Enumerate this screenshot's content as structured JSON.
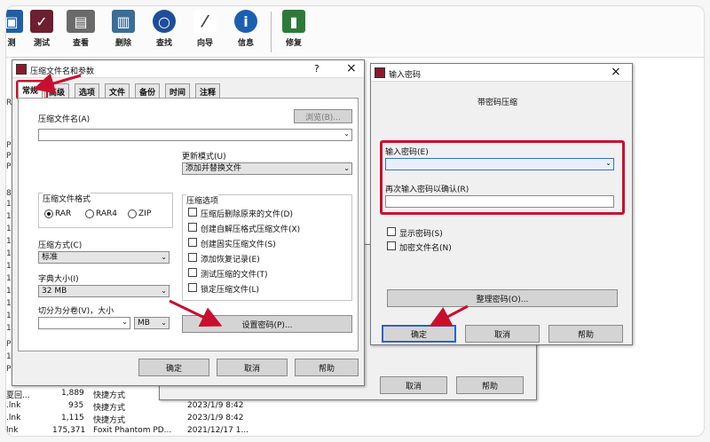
{
  "toolbar": {
    "items": [
      {
        "label": "测",
        "icon": "test-icon",
        "color": "#1f5fa8"
      },
      {
        "label": "测试",
        "icon": "test-clipboard-icon",
        "color": "#6b1f2f"
      },
      {
        "label": "查看",
        "icon": "book-icon",
        "color": "#6a6a6a"
      },
      {
        "label": "删除",
        "icon": "trash-icon",
        "color": "#3a6e98"
      },
      {
        "label": "查找",
        "icon": "magnifier-icon",
        "color": "#1d4e9a"
      },
      {
        "label": "向导",
        "icon": "wand-icon",
        "color": "#444444"
      },
      {
        "label": "信息",
        "icon": "info-icon",
        "color": "#1b5fb0"
      },
      {
        "label": "修复",
        "icon": "repair-book-icon",
        "color": "#2c7a3a"
      }
    ]
  },
  "leftcol": [
    "R",
    "P",
    "P",
    "P",
    "8",
    "1",
    "1",
    "1",
    "1",
    "1",
    "1",
    "1",
    "1",
    "1",
    "1",
    "1",
    "P",
    "1",
    "P"
  ],
  "files": [
    {
      "name": "夏回...",
      "size": "1,889",
      "type": "快捷方式",
      "date": ""
    },
    {
      "name": ".lnk",
      "size": "935",
      "type": "快捷方式",
      "date": "2023/1/9 8:42"
    },
    {
      "name": ".lnk",
      "size": "1,115",
      "type": "快捷方式",
      "date": "2023/1/9 8:42"
    },
    {
      "name": "lnk",
      "size": "175,371",
      "type": "Foxit Phantom PD...",
      "date": "2021/12/17 1..."
    }
  ],
  "dlg1": {
    "title": "压缩文件名和参数",
    "help_q": "?",
    "close": "×",
    "tabs": [
      "常规",
      "高级",
      "选项",
      "文件",
      "备份",
      "时间",
      "注释"
    ],
    "archive_name_label": "压缩文件名(A)",
    "browse": "浏览(B)...",
    "update_mode_label": "更新模式(U)",
    "update_mode_value": "添加并替换文件",
    "format_label": "压缩文件格式",
    "formats": [
      "RAR",
      "RAR4",
      "ZIP"
    ],
    "options_label": "压缩选项",
    "options": [
      "压缩后删除原来的文件(D)",
      "创建自解压格式压缩文件(X)",
      "创建固实压缩文件(S)",
      "添加恢复记录(E)",
      "测试压缩的文件(T)",
      "锁定压缩文件(L)"
    ],
    "method_label": "压缩方式(C)",
    "method_value": "标准",
    "dict_label": "字典大小(I)",
    "dict_value": "32 MB",
    "split_label": "切分为分卷(V)，大小",
    "split_unit": "MB",
    "set_password": "设置密码(P)...",
    "ok": "确定",
    "cancel": "取消",
    "help": "帮助"
  },
  "dlg_behind": {
    "cancel": "取消",
    "help": "帮助"
  },
  "dlg2": {
    "title": "输入密码",
    "close": "×",
    "subtitle": "带密码压缩",
    "enter_label": "输入密码(E)",
    "reenter_label": "再次输入密码以确认(R)",
    "show_password": "显示密码(S)",
    "encrypt_names": "加密文件名(N)",
    "organize": "整理密码(O)...",
    "ok": "确定",
    "cancel": "取消",
    "help": "帮助"
  },
  "colors": {
    "highlight": "#c8102e",
    "default_button_border": "#2b64c8"
  }
}
